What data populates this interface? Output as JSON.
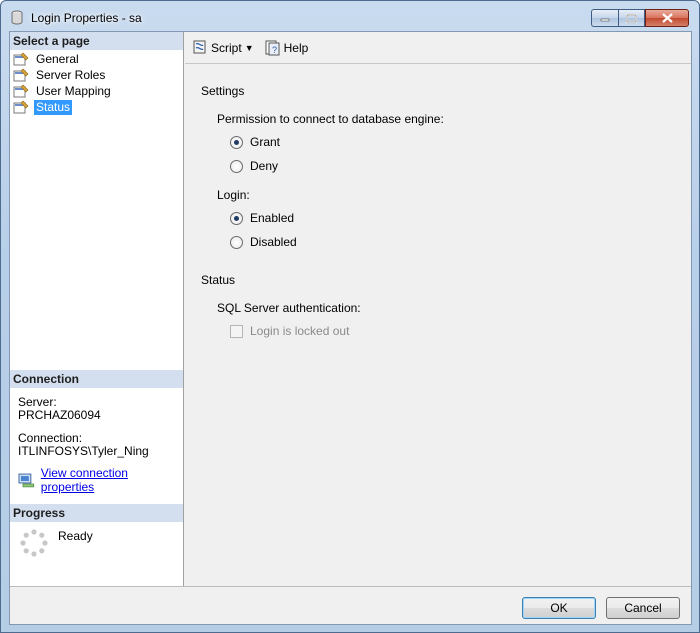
{
  "window": {
    "title": "Login Properties - sa"
  },
  "left_pane": {
    "select_page_header": "Select a page",
    "pages": [
      {
        "label": "General",
        "selected": false
      },
      {
        "label": "Server Roles",
        "selected": false
      },
      {
        "label": "User Mapping",
        "selected": false
      },
      {
        "label": "Status",
        "selected": true
      }
    ],
    "connection_header": "Connection",
    "server_label": "Server:",
    "server_value": "PRCHAZ06094",
    "connection_label": "Connection:",
    "connection_value": "ITLINFOSYS\\Tyler_Ning",
    "view_connection_link": "View connection properties",
    "progress_header": "Progress",
    "progress_status": "Ready"
  },
  "toolbar": {
    "script_label": "Script",
    "help_label": "Help"
  },
  "settings": {
    "header": "Settings",
    "permission_label": "Permission to connect to database engine:",
    "permission_options": [
      {
        "label": "Grant",
        "checked": true
      },
      {
        "label": "Deny",
        "checked": false
      }
    ],
    "login_label": "Login:",
    "login_options": [
      {
        "label": "Enabled",
        "checked": true
      },
      {
        "label": "Disabled",
        "checked": false
      }
    ]
  },
  "status": {
    "header": "Status",
    "sql_auth_label": "SQL Server authentication:",
    "locked_out_label": "Login is locked out",
    "locked_out_checked": false,
    "locked_out_enabled": false
  },
  "buttons": {
    "ok_label": "OK",
    "cancel_label": "Cancel"
  },
  "colors": {
    "selected_page": "#3399ff",
    "section_header": "#d3dfee",
    "link": "#0000e6"
  }
}
